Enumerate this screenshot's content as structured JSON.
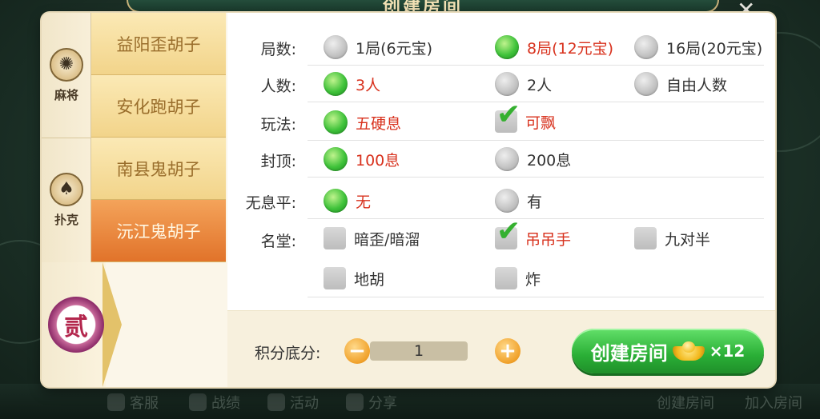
{
  "window": {
    "title": "创建房间",
    "close_icon": "close-icon"
  },
  "categories": [
    {
      "label": "麻将",
      "icon": "mahjong-icon",
      "glyph": "✺"
    },
    {
      "label": "扑克",
      "icon": "spade-icon",
      "glyph": "♠"
    }
  ],
  "level_badge": {
    "text": "贰",
    "icon": "level-badge-icon"
  },
  "games": [
    {
      "label": "益阳歪胡子",
      "active": false
    },
    {
      "label": "安化跑胡子",
      "active": false
    },
    {
      "label": "南县鬼胡子",
      "active": false
    },
    {
      "label": "沅江鬼胡子",
      "active": true
    }
  ],
  "options": {
    "rounds": {
      "label": "局数:",
      "choices": [
        "1局(6元宝)",
        "8局(12元宝)",
        "16局(20元宝)"
      ],
      "selected": 1
    },
    "players": {
      "label": "人数:",
      "choices": [
        "3人",
        "2人",
        "自由人数"
      ],
      "selected": 0
    },
    "mode": {
      "label": "玩法:",
      "radio": "五硬息",
      "check": "可飘"
    },
    "cap": {
      "label": "封顶:",
      "choices": [
        "100息",
        "200息"
      ],
      "selected": 0
    },
    "no_xi": {
      "label": "无息平:",
      "choices": [
        "无",
        "有"
      ],
      "selected": 0
    },
    "mingtang": {
      "label": "名堂:",
      "items": [
        {
          "label": "暗歪/暗溜",
          "checked": false
        },
        {
          "label": "吊吊手",
          "checked": true
        },
        {
          "label": "九对半",
          "checked": false
        },
        {
          "label": "地胡",
          "checked": false
        },
        {
          "label": "炸",
          "checked": false
        }
      ]
    }
  },
  "footer": {
    "score_label": "积分底分:",
    "score_value": "1",
    "minus": "−",
    "plus": "+",
    "create_label": "创建房间",
    "cost": "×12"
  },
  "background": {
    "bottom_items": [
      "客服",
      "战绩",
      "活动",
      "分享",
      "创建房间",
      "加入房间"
    ]
  },
  "colors": {
    "selected_text": "#d8311d",
    "radio_on": "#3fc23a",
    "tab_active": "#e1732a",
    "create_button": "#2aaf36"
  }
}
